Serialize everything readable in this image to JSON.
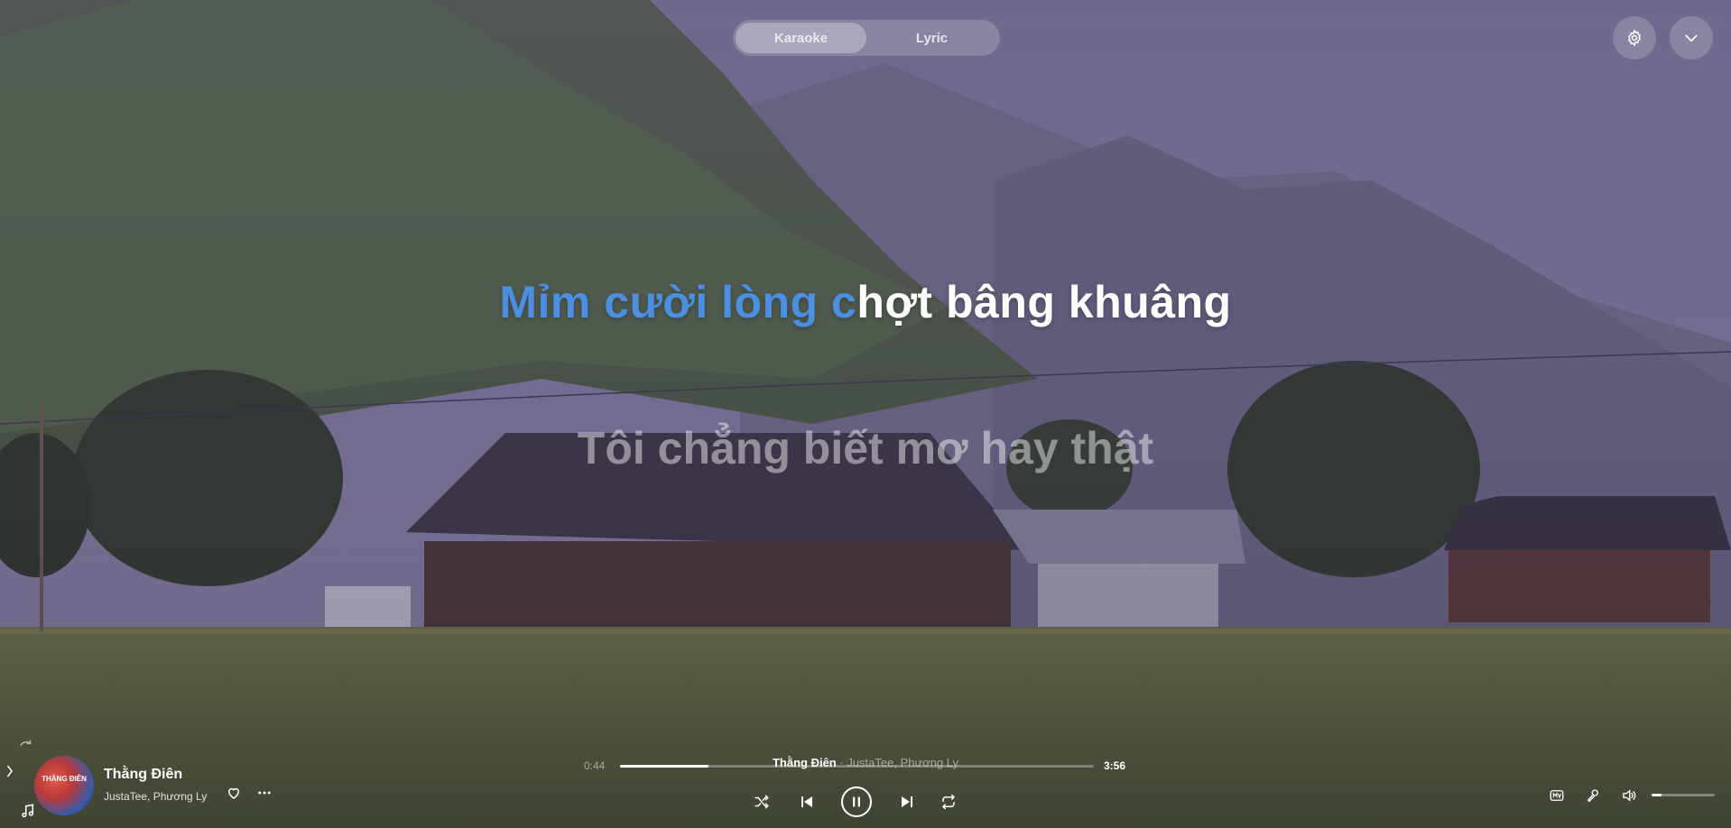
{
  "modes": {
    "tabs": [
      {
        "label": "Karaoke",
        "active": true
      },
      {
        "label": "Lyric",
        "active": false
      }
    ]
  },
  "top_controls": {
    "settings_icon": "gear-icon",
    "collapse_icon": "chevron-down-icon"
  },
  "lyrics": {
    "current_sung": "Mỉm cười lòng c",
    "current_unsung": "hợt bâng khuâng",
    "next_line": "Tôi chẳng biết mơ hay thật"
  },
  "now_playing": {
    "title": "Thằng Điên",
    "artists": "JustaTee, Phương Ly",
    "album_art_text": "THẰNG ĐIÊN",
    "elapsed": "0:44",
    "duration": "3:56",
    "progress_fraction": 0.186,
    "center_title": "Thằng Điên",
    "center_separator": " · ",
    "center_artists": "JustaTee, Phương Ly"
  },
  "volume": {
    "level_fraction": 0.15
  },
  "colors": {
    "lyric_sung": "#4a8fe0",
    "lyric_unsung": "#ffffff",
    "accent": "#ffffff"
  }
}
